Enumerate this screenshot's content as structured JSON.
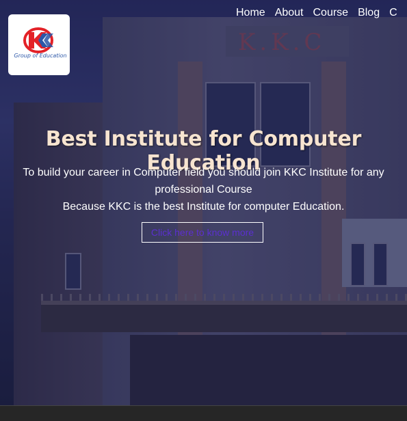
{
  "logo": {
    "mark_text": "KKC",
    "tagline": "Group of Education",
    "colors": {
      "red": "#e32127",
      "blue": "#2c57a8"
    }
  },
  "building_sign": "K.K.C",
  "nav": {
    "items": [
      {
        "label": "Home"
      },
      {
        "label": "About"
      },
      {
        "label": "Course"
      },
      {
        "label": "Blog"
      },
      {
        "label": "C"
      }
    ]
  },
  "hero": {
    "title": "Best Institute for Computer Education",
    "line1": "To build your career in Computer field you should join KKC Institute for any professional Course",
    "line2": "Because KKC is the best Institute for computer Education.",
    "cta_label": "Click here to know more",
    "title_color": "#f7e4d0",
    "cta_color": "#5b2fd0"
  }
}
